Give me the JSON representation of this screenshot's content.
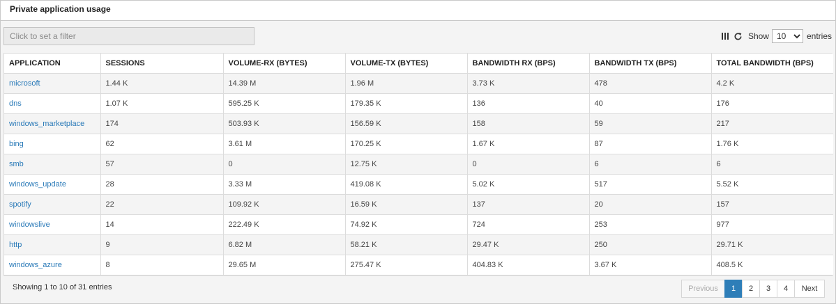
{
  "panel": {
    "title": "Private application usage"
  },
  "toolbar": {
    "filter_placeholder": "Click to set a filter",
    "show_label": "Show",
    "entries_label": "entries",
    "entries_value": "10"
  },
  "table": {
    "columns": [
      "APPLICATION",
      "SESSIONS",
      "VOLUME-RX (BYTES)",
      "VOLUME-TX (BYTES)",
      "BANDWIDTH RX (BPS)",
      "BANDWIDTH TX (BPS)",
      "TOTAL BANDWIDTH (BPS)"
    ],
    "rows": [
      [
        "microsoft",
        "1.44 K",
        "14.39 M",
        "1.96 M",
        "3.73 K",
        "478",
        "4.2 K"
      ],
      [
        "dns",
        "1.07 K",
        "595.25 K",
        "179.35 K",
        "136",
        "40",
        "176"
      ],
      [
        "windows_marketplace",
        "174",
        "503.93 K",
        "156.59 K",
        "158",
        "59",
        "217"
      ],
      [
        "bing",
        "62",
        "3.61 M",
        "170.25 K",
        "1.67 K",
        "87",
        "1.76 K"
      ],
      [
        "smb",
        "57",
        "0",
        "12.75 K",
        "0",
        "6",
        "6"
      ],
      [
        "windows_update",
        "28",
        "3.33 M",
        "419.08 K",
        "5.02 K",
        "517",
        "5.52 K"
      ],
      [
        "spotify",
        "22",
        "109.92 K",
        "16.59 K",
        "137",
        "20",
        "157"
      ],
      [
        "windowslive",
        "14",
        "222.49 K",
        "74.92 K",
        "724",
        "253",
        "977"
      ],
      [
        "http",
        "9",
        "6.82 M",
        "58.21 K",
        "29.47 K",
        "250",
        "29.71 K"
      ],
      [
        "windows_azure",
        "8",
        "29.65 M",
        "275.47 K",
        "404.83 K",
        "3.67 K",
        "408.5 K"
      ]
    ]
  },
  "footer": {
    "info": "Showing 1 to 10 of 31 entries"
  },
  "pagination": {
    "previous": "Previous",
    "pages": [
      "1",
      "2",
      "3",
      "4"
    ],
    "next": "Next"
  },
  "colors": {
    "link": "#2a7ab8",
    "active_page": "#2e7eb8"
  }
}
